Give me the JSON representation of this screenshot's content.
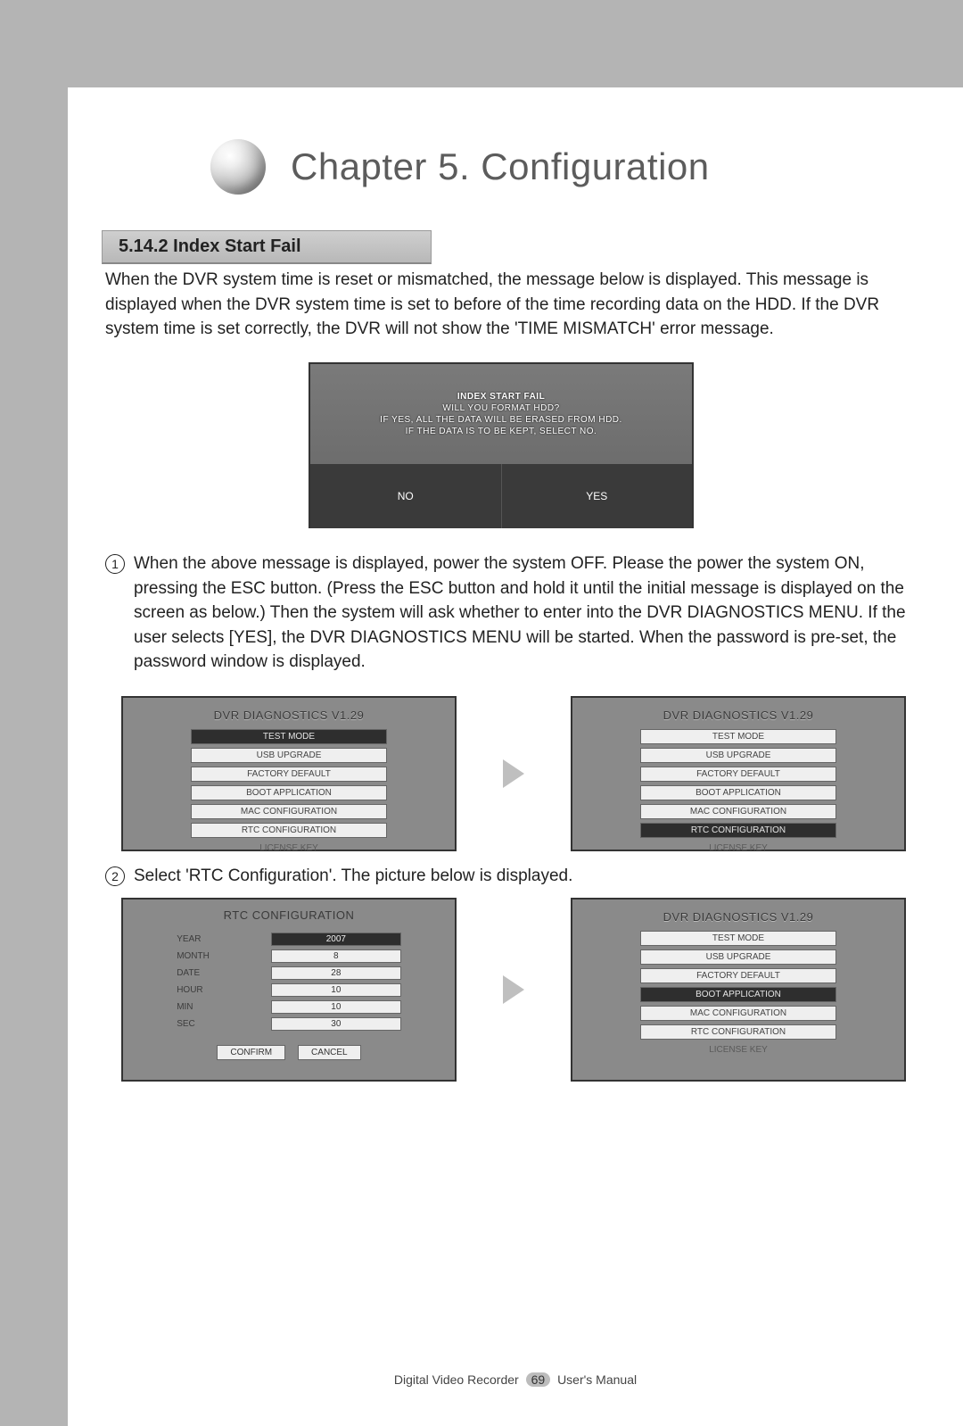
{
  "chapter_title": "Chapter 5. Configuration",
  "section_heading": "5.14.2 Index Start Fail",
  "intro_paragraph": "When the DVR system time is reset or mismatched, the message below is displayed. This message is displayed when the DVR system time is set to before of the time recording data on the HDD. If the DVR system time is set correctly, the DVR will not show the 'TIME MISMATCH' error message.",
  "index_fail_shot": {
    "title": "INDEX START FAIL",
    "line1": "WILL YOU FORMAT HDD?",
    "line2": "IF YES, ALL THE DATA WILL BE ERASED FROM HDD.",
    "line3": "IF THE DATA IS TO BE KEPT, SELECT NO.",
    "no": "NO",
    "yes": "YES"
  },
  "step1_num": "1",
  "step1_text": "When the above message is displayed, power the system OFF. Please the power the system ON, pressing the ESC button. (Press the ESC button and hold it until the initial message is displayed on the screen as below.) Then the system will ask whether to enter into the DVR DIAGNOSTICS MENU. If the user selects [YES], the DVR DIAGNOSTICS MENU will be started. When the password is pre-set, the password window is displayed.",
  "diag_menu": {
    "title": "DVR DIAGNOSTICS V1.29",
    "items": [
      "TEST MODE",
      "USB UPGRADE",
      "FACTORY DEFAULT",
      "BOOT APPLICATION",
      "MAC CONFIGURATION",
      "RTC CONFIGURATION",
      "LICENSE KEY"
    ]
  },
  "diag_menu_left_selected_index": 0,
  "diag_menu_right_selected_index": 5,
  "step2_num": "2",
  "step2_text": "Select 'RTC Configuration'. The picture below is displayed.",
  "rtc": {
    "title": "RTC CONFIGURATION",
    "rows": [
      {
        "label": "YEAR",
        "value": "2007"
      },
      {
        "label": "MONTH",
        "value": "8"
      },
      {
        "label": "DATE",
        "value": "28"
      },
      {
        "label": "HOUR",
        "value": "10"
      },
      {
        "label": "MIN",
        "value": "10"
      },
      {
        "label": "SEC",
        "value": "30"
      }
    ],
    "confirm": "CONFIRM",
    "cancel": "CANCEL"
  },
  "diag_menu2_selected_index": 3,
  "footer": {
    "left": "Digital Video Recorder",
    "page": "69",
    "right": "User's Manual"
  }
}
